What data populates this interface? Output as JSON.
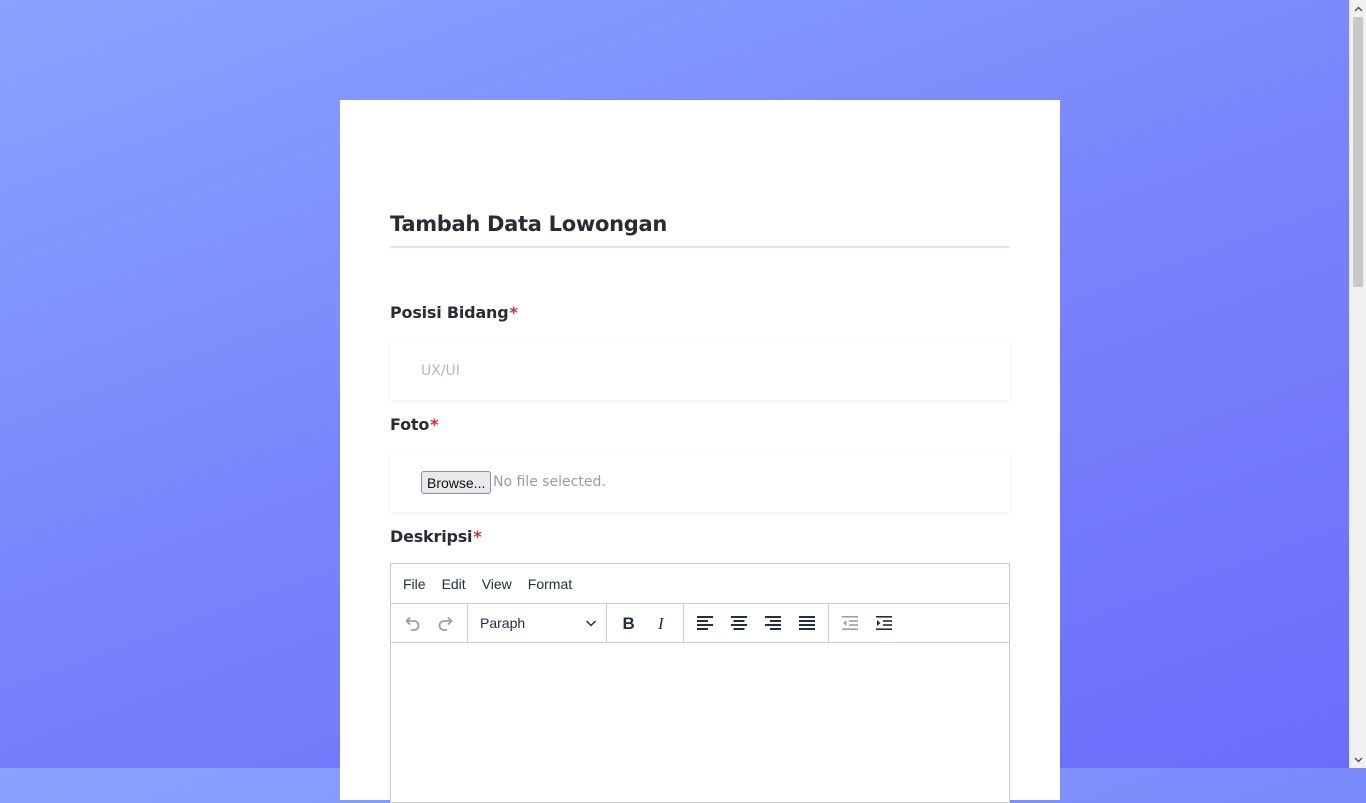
{
  "form": {
    "title": "Tambah Data Lowongan",
    "required_marker": "*",
    "posisi": {
      "label": "Posisi Bidang",
      "placeholder": "UX/UI"
    },
    "foto": {
      "label": "Foto",
      "browse_label": "Browse...",
      "status": "No file selected."
    },
    "deskripsi": {
      "label": "Deskripsi"
    }
  },
  "editor": {
    "menu": [
      "File",
      "Edit",
      "View",
      "Format"
    ],
    "block_format": "Paraph"
  },
  "icons": {
    "undo": "undo-icon",
    "redo": "redo-icon",
    "dropdown": "chevron-down-icon",
    "bold": "bold-icon",
    "italic": "italic-icon",
    "align_left": "align-left-icon",
    "align_center": "align-center-icon",
    "align_right": "align-right-icon",
    "align_justify": "align-justify-icon",
    "outdent": "outdent-icon",
    "indent": "indent-icon"
  },
  "colors": {
    "background_top": "#8aa3ff",
    "background_bottom": "#6c6cfb",
    "required": "#e0263a",
    "title_text": "#2b2b36"
  }
}
